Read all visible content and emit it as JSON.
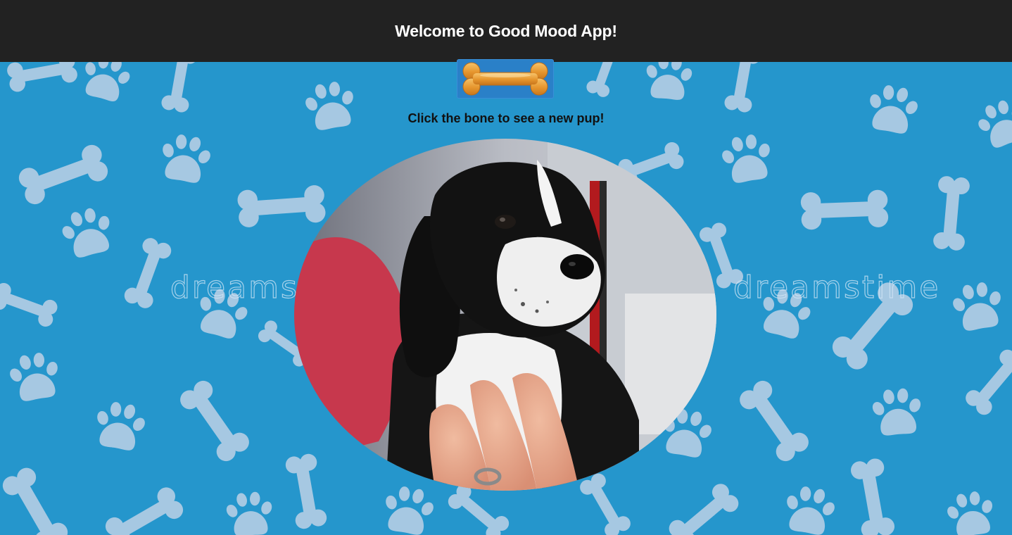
{
  "header": {
    "title": "Welcome to Good Mood App!"
  },
  "main": {
    "bone_button_icon": "dog-bone-icon",
    "instruction": "Click the bone to see a new pup!",
    "photo_subject": "black-and-white-spaniel-puppy"
  },
  "watermark": {
    "text": "dreamstime"
  },
  "colors": {
    "header_bg": "#222222",
    "background": "#2596cc",
    "pattern": "#a6c8e2",
    "bone_button": "#e6962e"
  }
}
